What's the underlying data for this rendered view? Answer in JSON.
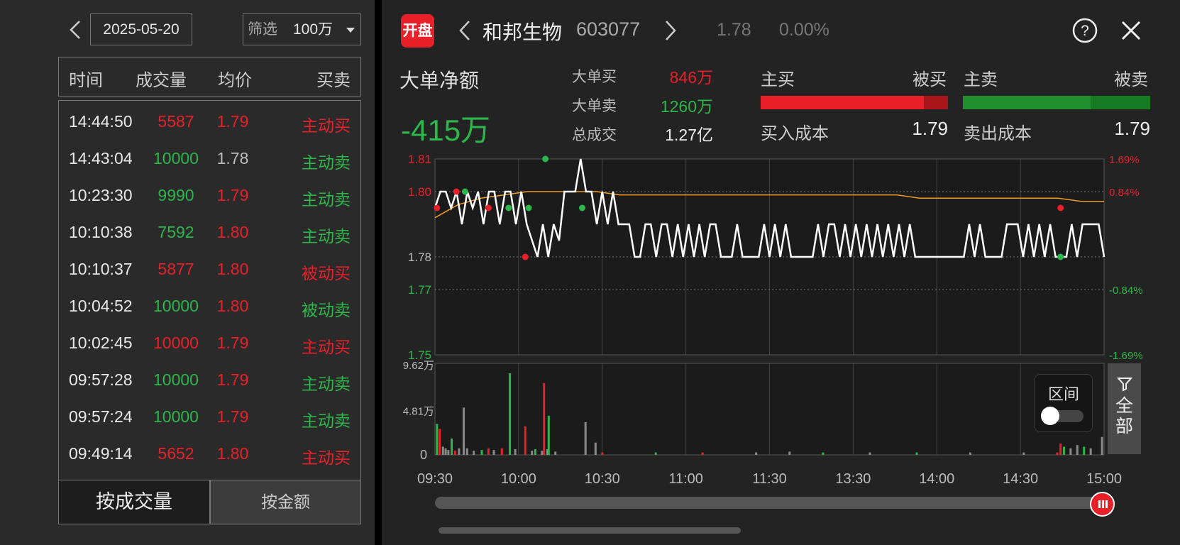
{
  "left": {
    "date": "2025-05-20",
    "filter_label": "筛选",
    "filter_value": "100万",
    "columns": [
      "时间",
      "成交量",
      "均价",
      "买卖"
    ],
    "rows": [
      {
        "time": "14:44:50",
        "vol": "5587",
        "price": "1.79",
        "side": "主动买",
        "vc": "red",
        "pc": "red",
        "sc": "red"
      },
      {
        "time": "14:43:04",
        "vol": "10000",
        "price": "1.78",
        "side": "主动卖",
        "vc": "green",
        "pc": "gray",
        "sc": "green"
      },
      {
        "time": "10:23:30",
        "vol": "9990",
        "price": "1.79",
        "side": "主动卖",
        "vc": "green",
        "pc": "red",
        "sc": "green"
      },
      {
        "time": "10:10:38",
        "vol": "7592",
        "price": "1.80",
        "side": "主动卖",
        "vc": "green",
        "pc": "red",
        "sc": "green"
      },
      {
        "time": "10:10:37",
        "vol": "5877",
        "price": "1.80",
        "side": "被动买",
        "vc": "red",
        "pc": "red",
        "sc": "red"
      },
      {
        "time": "10:04:52",
        "vol": "10000",
        "price": "1.80",
        "side": "被动卖",
        "vc": "green",
        "pc": "red",
        "sc": "green"
      },
      {
        "time": "10:02:45",
        "vol": "10000",
        "price": "1.79",
        "side": "主动买",
        "vc": "red",
        "pc": "red",
        "sc": "red"
      },
      {
        "time": "09:57:28",
        "vol": "10000",
        "price": "1.79",
        "side": "主动卖",
        "vc": "green",
        "pc": "red",
        "sc": "green"
      },
      {
        "time": "09:57:24",
        "vol": "10000",
        "price": "1.79",
        "side": "主动卖",
        "vc": "green",
        "pc": "red",
        "sc": "green"
      },
      {
        "time": "09:49:14",
        "vol": "5652",
        "price": "1.80",
        "side": "主动买",
        "vc": "red",
        "pc": "red",
        "sc": "red"
      }
    ],
    "btn_volume": "按成交量",
    "btn_amount": "按金额"
  },
  "header": {
    "logo": "开盘",
    "name": "和邦生物",
    "code": "603077",
    "price": "1.78",
    "pct": "0.00%"
  },
  "summary": {
    "net_label": "大单净额",
    "net_value": "-415万",
    "big_buy_label": "大单买",
    "big_buy": "846万",
    "big_sell_label": "大单卖",
    "big_sell": "1260万",
    "total_label": "总成交",
    "total": "1.27亿",
    "main_buy": "主买",
    "passive_buy": "被买",
    "main_sell": "主卖",
    "passive_sell": "被卖",
    "buy_cost_label": "买入成本",
    "buy_cost": "1.79",
    "sell_cost_label": "卖出成本",
    "sell_cost": "1.79",
    "buy_main_fraction": 0.87,
    "sell_main_fraction": 0.68
  },
  "toggle": {
    "label": "区间",
    "on": false
  },
  "filter_side": {
    "label": "全部"
  },
  "chart_data": {
    "type": "line",
    "y_left_ticks": [
      "1.81",
      "1.80",
      "1.78",
      "1.77",
      "1.75"
    ],
    "y_right_ticks": [
      "1.69%",
      "0.84%",
      "",
      "-0.84%",
      "-1.69%"
    ],
    "ylim": [
      1.75,
      1.81
    ],
    "vol_ticks": [
      "9.62万",
      "4.81万",
      "0"
    ],
    "x_ticks": [
      "09:30",
      "10:00",
      "10:30",
      "11:00",
      "11:30",
      "13:30",
      "14:00",
      "14:30",
      "15:00"
    ],
    "series": [
      {
        "values": [
          1.795,
          1.8,
          1.8,
          1.795,
          1.8,
          1.79,
          1.8,
          1.795,
          1.8,
          1.79,
          1.8,
          1.8,
          1.79,
          1.8,
          1.8,
          1.79,
          1.8,
          1.79,
          1.785,
          1.78,
          1.79,
          1.78,
          1.79,
          1.785,
          1.8,
          1.8,
          1.8,
          1.81,
          1.8,
          1.8,
          1.79,
          1.8,
          1.79,
          1.8,
          1.79,
          1.79,
          1.79,
          1.78,
          1.78,
          1.79,
          1.79,
          1.78,
          1.79,
          1.79,
          1.78,
          1.79,
          1.78,
          1.79,
          1.78,
          1.79,
          1.78,
          1.79,
          1.79,
          1.78,
          1.78,
          1.78,
          1.79,
          1.78,
          1.78,
          1.78,
          1.78,
          1.79,
          1.78,
          1.79,
          1.78,
          1.79,
          1.78,
          1.78,
          1.78,
          1.78,
          1.78,
          1.79,
          1.78,
          1.79,
          1.79,
          1.78,
          1.79,
          1.78,
          1.79,
          1.78,
          1.79,
          1.78,
          1.79,
          1.78,
          1.79,
          1.78,
          1.79,
          1.78,
          1.79,
          1.78,
          1.78,
          1.78,
          1.78,
          1.78,
          1.78,
          1.78,
          1.78,
          1.78,
          1.78,
          1.79,
          1.78,
          1.79,
          1.78,
          1.78,
          1.78,
          1.78,
          1.79,
          1.79,
          1.79,
          1.78,
          1.79,
          1.78,
          1.79,
          1.78,
          1.79,
          1.78,
          1.78,
          1.78,
          1.79,
          1.78,
          1.79,
          1.79,
          1.79,
          1.79,
          1.78
        ]
      },
      {
        "values": [
          1.792,
          1.796,
          1.798,
          1.799,
          1.8,
          1.8,
          1.8,
          1.8,
          1.799,
          1.799,
          1.799,
          1.799,
          1.799,
          1.799,
          1.799,
          1.799,
          1.799,
          1.799,
          1.799,
          1.799,
          1.799,
          1.798,
          1.798,
          1.798,
          1.798,
          1.798,
          1.798,
          1.798,
          1.797,
          1.797
        ]
      }
    ],
    "markers": [
      {
        "t": 0.003,
        "v": 1.795,
        "c": "red"
      },
      {
        "t": 0.032,
        "v": 1.8,
        "c": "red"
      },
      {
        "t": 0.045,
        "v": 1.8,
        "c": "green"
      },
      {
        "t": 0.08,
        "v": 1.795,
        "c": "red"
      },
      {
        "t": 0.11,
        "v": 1.795,
        "c": "green"
      },
      {
        "t": 0.135,
        "v": 1.78,
        "c": "red"
      },
      {
        "t": 0.14,
        "v": 1.795,
        "c": "green"
      },
      {
        "t": 0.165,
        "v": 1.81,
        "c": "green"
      },
      {
        "t": 0.22,
        "v": 1.795,
        "c": "green"
      },
      {
        "t": 0.935,
        "v": 1.795,
        "c": "red"
      },
      {
        "t": 0.935,
        "v": 1.78,
        "c": "green"
      }
    ],
    "volume_bars": [
      {
        "t": 0.003,
        "v": 0.38,
        "c": "green"
      },
      {
        "t": 0.007,
        "v": 0.32,
        "c": "red"
      },
      {
        "t": 0.012,
        "v": 0.1,
        "c": "gray"
      },
      {
        "t": 0.016,
        "v": 0.08,
        "c": "gray"
      },
      {
        "t": 0.02,
        "v": 0.06,
        "c": "gray"
      },
      {
        "t": 0.025,
        "v": 0.2,
        "c": "green"
      },
      {
        "t": 0.03,
        "v": 0.05,
        "c": "red"
      },
      {
        "t": 0.036,
        "v": 0.08,
        "c": "gray"
      },
      {
        "t": 0.043,
        "v": 0.58,
        "c": "gray"
      },
      {
        "t": 0.048,
        "v": 0.08,
        "c": "gray"
      },
      {
        "t": 0.058,
        "v": 0.05,
        "c": "gray"
      },
      {
        "t": 0.07,
        "v": 0.06,
        "c": "green"
      },
      {
        "t": 0.08,
        "v": 0.08,
        "c": "red"
      },
      {
        "t": 0.088,
        "v": 0.06,
        "c": "gray"
      },
      {
        "t": 0.1,
        "v": 0.08,
        "c": "red"
      },
      {
        "t": 0.112,
        "v": 1.0,
        "c": "green"
      },
      {
        "t": 0.12,
        "v": 0.07,
        "c": "gray"
      },
      {
        "t": 0.135,
        "v": 0.35,
        "c": "red"
      },
      {
        "t": 0.145,
        "v": 0.05,
        "c": "gray"
      },
      {
        "t": 0.15,
        "v": 0.07,
        "c": "green"
      },
      {
        "t": 0.16,
        "v": 0.05,
        "c": "gray"
      },
      {
        "t": 0.163,
        "v": 0.88,
        "c": "red"
      },
      {
        "t": 0.168,
        "v": 0.07,
        "c": "gray"
      },
      {
        "t": 0.17,
        "v": 0.48,
        "c": "green"
      },
      {
        "t": 0.18,
        "v": 0.04,
        "c": "gray"
      },
      {
        "t": 0.225,
        "v": 0.4,
        "c": "gray"
      },
      {
        "t": 0.24,
        "v": 0.15,
        "c": "gray"
      },
      {
        "t": 0.25,
        "v": 0.03,
        "c": "red"
      },
      {
        "t": 0.33,
        "v": 0.03,
        "c": "green"
      },
      {
        "t": 0.4,
        "v": 0.03,
        "c": "red"
      },
      {
        "t": 0.48,
        "v": 0.03,
        "c": "gray"
      },
      {
        "t": 0.53,
        "v": 0.04,
        "c": "gray"
      },
      {
        "t": 0.58,
        "v": 0.03,
        "c": "green"
      },
      {
        "t": 0.65,
        "v": 0.03,
        "c": "gray"
      },
      {
        "t": 0.72,
        "v": 0.03,
        "c": "green"
      },
      {
        "t": 0.8,
        "v": 0.03,
        "c": "gray"
      },
      {
        "t": 0.88,
        "v": 0.03,
        "c": "gray"
      },
      {
        "t": 0.93,
        "v": 0.03,
        "c": "red"
      },
      {
        "t": 0.935,
        "v": 0.14,
        "c": "red"
      },
      {
        "t": 0.94,
        "v": 0.1,
        "c": "green"
      },
      {
        "t": 0.95,
        "v": 0.08,
        "c": "gray"
      },
      {
        "t": 0.96,
        "v": 0.12,
        "c": "gray"
      },
      {
        "t": 0.97,
        "v": 0.1,
        "c": "green"
      },
      {
        "t": 0.98,
        "v": 0.08,
        "c": "gray"
      },
      {
        "t": 0.997,
        "v": 0.22,
        "c": "gray"
      }
    ]
  },
  "colors": {
    "red": "#e8202a",
    "green": "#2db64b",
    "orange": "#f29c1f",
    "line": "#ffffff",
    "bg": "#232323"
  }
}
